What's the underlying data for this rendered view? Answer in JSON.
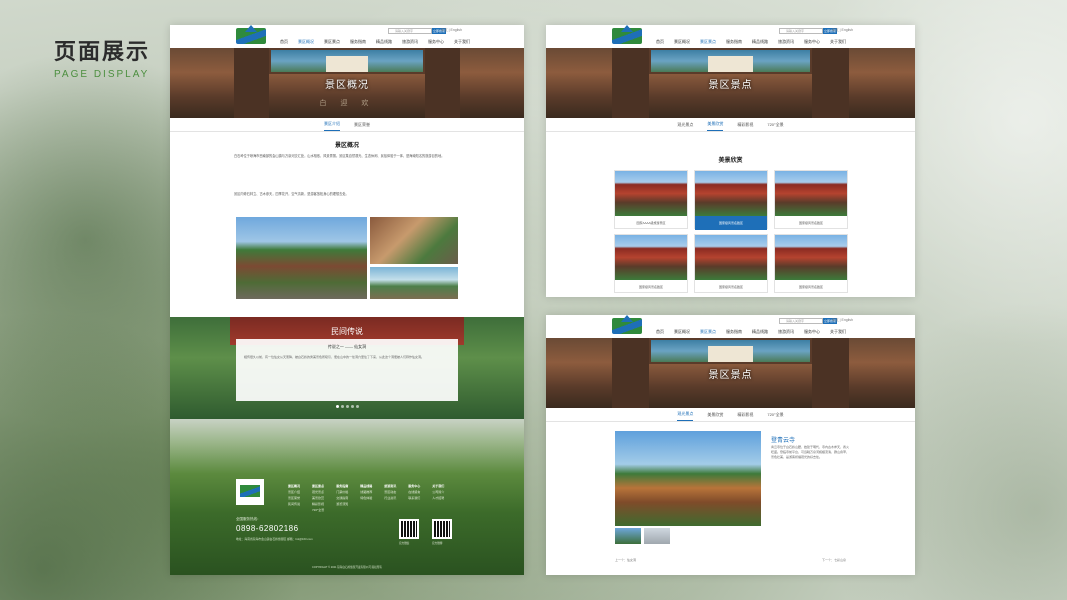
{
  "heading": {
    "title_cn": "页面展示",
    "title_en": "PAGE DISPLAY"
  },
  "nav": {
    "search_placeholder": "请输入关键字",
    "search_button": "立即搜索",
    "lang": "中文 | English",
    "menu": [
      "首页",
      "景区概况",
      "景区景点",
      "服务指南",
      "精品线路",
      "旅游资讯",
      "服务中心",
      "关于我们"
    ]
  },
  "panelA": {
    "banner_title": "景区概况",
    "banner_lettering": "白 迎 欢",
    "tabs": [
      "景区介绍",
      "景区荣誉"
    ],
    "section_title": "景区概况",
    "para1": "白石岭位于琼海市西南部的会山镇与万泉河交汇处，山水相依，风景秀丽。景区集自然观光、生态休闲、民俗体验于一体，是海南知名的旅游目的地。",
    "para2": "景区内奇石林立、古木参天，四季花开，空气清新，是游客放松身心的理想去处。",
    "legend_title": "民间传说",
    "legend_sub": "传说之一 —— 仙女洞",
    "legend_text": "相传很久以前，有一位仙女从天而降，被白石岭的秀美景色所吸引，便在山中的一处洞穴里住了下来，从此这个洞便被人们称作仙女洞。",
    "footer_cols": [
      {
        "head": "景区概况",
        "items": [
          "景区介绍",
          "景区荣誉",
          "民间传说"
        ]
      },
      {
        "head": "景区景点",
        "items": [
          "观光景点",
          "美景欣赏",
          "精彩影视",
          "720°全景"
        ]
      },
      {
        "head": "服务指南",
        "items": [
          "门票价格",
          "交通指南",
          "游览须知"
        ]
      },
      {
        "head": "精品线路",
        "items": [
          "线路推荐",
          "特色体验"
        ]
      },
      {
        "head": "旅游资讯",
        "items": [
          "景区动态",
          "行业资讯"
        ]
      },
      {
        "head": "服务中心",
        "items": [
          "在线留言",
          "联系我们"
        ]
      },
      {
        "head": "关于我们",
        "items": [
          "公司简介",
          "人才招聘"
        ]
      }
    ],
    "hotline_label": "全国服务热线：",
    "phone": "0898-62802186",
    "address": "地址：海南省琼海市会山镇白石岭旅游区 邮箱：bsl@163.com",
    "qr_labels": [
      "官方微信",
      "官方微博"
    ],
    "copyright": "COPYRIGHT © 2021 琼海白石岭旅游开发有限公司 版权所有"
  },
  "panelB": {
    "banner_title": "景区景点",
    "tabs": [
      "观光景点",
      "美景欣赏",
      "精彩影视",
      "720°全景"
    ],
    "grid_title": "美景欣赏",
    "captions": [
      "国家AAAA级旅游景区",
      "国家级风景名胜区",
      "国家级风景名胜区",
      "国家级风景名胜区",
      "国家级风景名胜区",
      "国家级风景名胜区"
    ]
  },
  "panelC": {
    "banner_title": "景区景点",
    "tabs": [
      "观光景点",
      "美景欣赏",
      "精彩影视",
      "720°全景"
    ],
    "detail_title": "登青云寺",
    "detail_text": "青云寺位于白石岭山腰，始建于明代，寺内古木参天，香火旺盛。登临寺前平台，可远眺万泉河蜿蜒流淌，群山叠翠，景色壮美，是游客祈福观光的好去处。",
    "prev": "上一个：仙女洞",
    "next": "下一个：七彩山泉"
  }
}
